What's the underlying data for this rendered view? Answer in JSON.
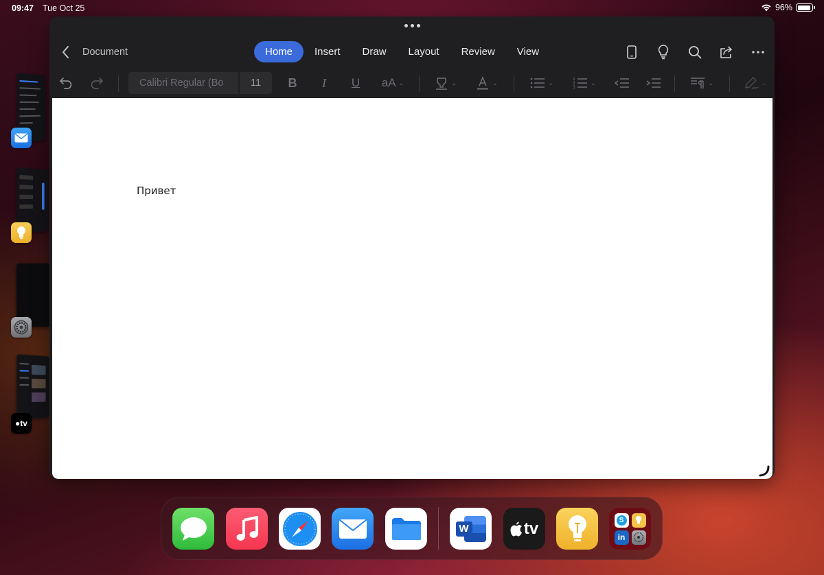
{
  "status_bar": {
    "time": "09:47",
    "date": "Tue Oct 25",
    "battery_percent": "96%",
    "battery_level": 0.96
  },
  "stage_manager": {
    "apps": [
      {
        "name": "Mail",
        "icon": "mail-icon"
      },
      {
        "name": "Tips",
        "icon": "lightbulb-icon"
      },
      {
        "name": "Settings",
        "icon": "gear-icon"
      },
      {
        "name": "Apple TV",
        "icon": "apple-tv-icon",
        "icon_text": "tv"
      }
    ]
  },
  "window": {
    "doc_title": "Document",
    "tabs": [
      {
        "label": "Home",
        "active": true
      },
      {
        "label": "Insert",
        "active": false
      },
      {
        "label": "Draw",
        "active": false
      },
      {
        "label": "Layout",
        "active": false
      },
      {
        "label": "Review",
        "active": false
      },
      {
        "label": "View",
        "active": false
      }
    ],
    "title_tools": [
      "phone-view-icon",
      "lightbulb-icon",
      "search-icon",
      "share-icon",
      "more-icon"
    ],
    "ribbon": {
      "font_name": "Calibri Regular (Bo",
      "font_size": "11",
      "bold_label": "B",
      "italic_label": "I",
      "underline_label": "U",
      "text_case_label": "aA"
    },
    "document_text": "Привет"
  },
  "dock": {
    "apps": [
      {
        "name": "Messages",
        "icon": "messages-icon"
      },
      {
        "name": "Music",
        "icon": "music-icon"
      },
      {
        "name": "Safari",
        "icon": "safari-icon"
      },
      {
        "name": "Mail",
        "icon": "mail-icon"
      },
      {
        "name": "Files",
        "icon": "files-icon"
      },
      {
        "name": "Word",
        "icon": "word-icon",
        "icon_text": "W"
      },
      {
        "name": "Apple TV",
        "icon": "apple-tv-icon",
        "icon_text": "tv"
      },
      {
        "name": "Tips",
        "icon": "lightbulb-icon"
      },
      {
        "name": "App Library",
        "icon": "app-folder-icon",
        "icon_text": "S",
        "icon_text_2": "in"
      }
    ]
  },
  "colors": {
    "accent": "#3b6bdb",
    "window_bg": "#1f1f21",
    "page_bg": "#ffffff"
  }
}
